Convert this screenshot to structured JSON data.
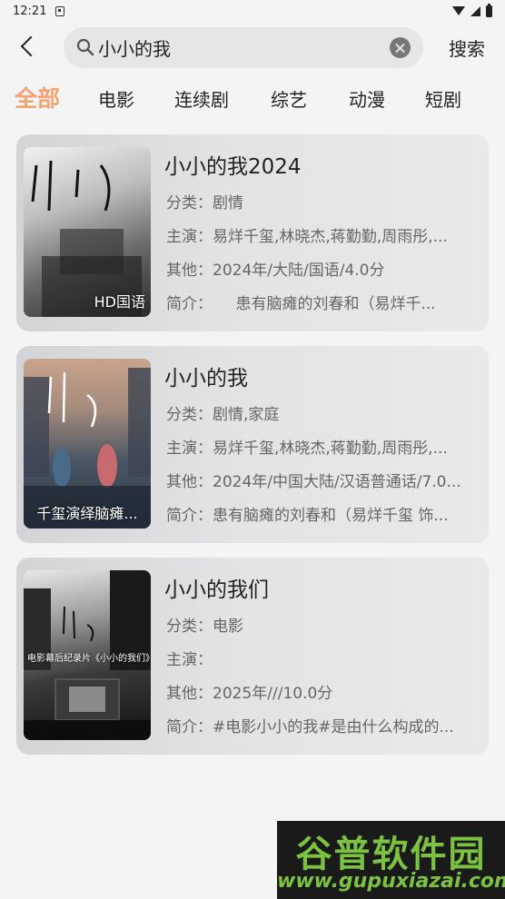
{
  "status_bar": {
    "time": "12:21"
  },
  "search": {
    "value": "小小的我",
    "button_label": "搜索"
  },
  "tabs": [
    {
      "label": "全部",
      "active": true
    },
    {
      "label": "电影",
      "active": false
    },
    {
      "label": "连续剧",
      "active": false
    },
    {
      "label": "综艺",
      "active": false
    },
    {
      "label": "动漫",
      "active": false
    },
    {
      "label": "短剧",
      "active": false
    }
  ],
  "colors": {
    "accent": "#f4a372",
    "watermark_green": "#7cc242"
  },
  "results": [
    {
      "title": "小小的我2024",
      "poster_caption": "HD国语",
      "category_label": "分类：",
      "category": "剧情",
      "cast_label": "主演：",
      "cast": "易烊千玺,林晓杰,蒋勤勤,周雨彤,...",
      "other_label": "其他：",
      "other": "2024年/大陆/国语/4.0分",
      "intro_label": "简介：",
      "intro": "　　患有脑瘫的刘春和（易烊千..."
    },
    {
      "title": "小小的我",
      "poster_caption": "千玺演绎脑瘫...",
      "category_label": "分类：",
      "category": "剧情,家庭",
      "cast_label": "主演：",
      "cast": "易烊千玺,林晓杰,蒋勤勤,周雨彤,...",
      "other_label": "其他：",
      "other": "2024年/中国大陆/汉语普通话/7.0...",
      "intro_label": "简介：",
      "intro": "患有脑瘫的刘春和（易烊千玺 饰..."
    },
    {
      "title": "小小的我们",
      "poster_caption": "电影幕后纪录片《小小的我们》",
      "category_label": "分类：",
      "category": "电影",
      "cast_label": "主演：",
      "cast": "",
      "other_label": "其他：",
      "other": "2025年///10.0分",
      "intro_label": "简介：",
      "intro": "#电影小小的我#是由什么构成的..."
    }
  ],
  "watermark": {
    "top": "谷普软件园",
    "bottom": "www.gupuxiazai.com"
  }
}
